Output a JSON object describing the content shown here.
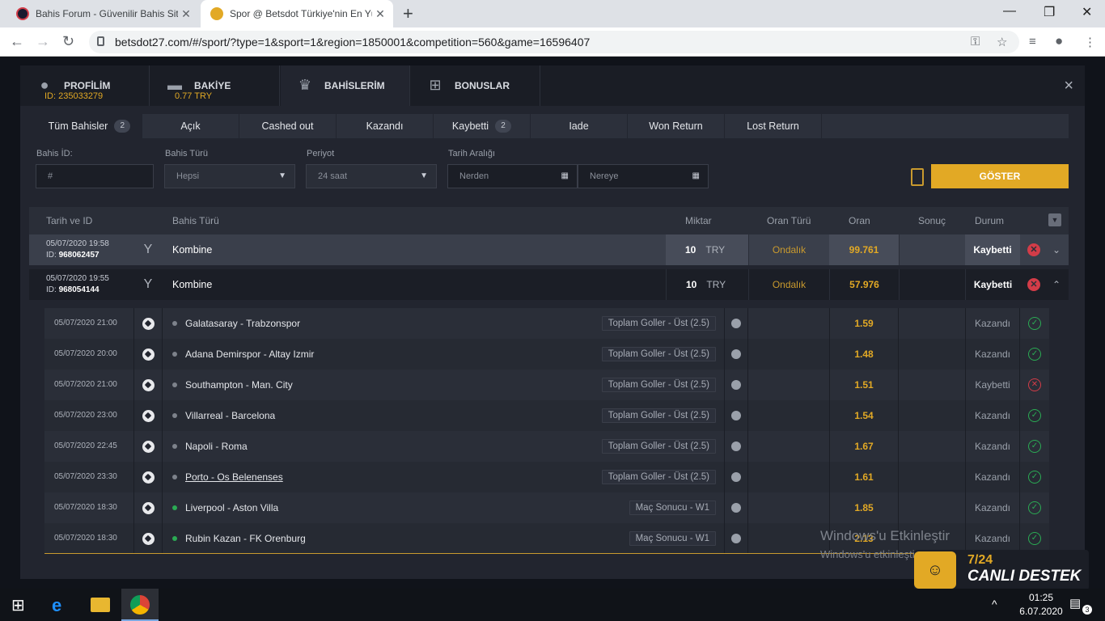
{
  "browser": {
    "tabs": [
      {
        "title": "Bahis Forum - Güvenilir Bahis Sitel",
        "favicon_color": "#1a1a2e"
      },
      {
        "title": "Spor @ Betsdot Türkiye'nin En Yüc",
        "favicon_color": "#e2a925"
      }
    ],
    "url": "betsdot27.com/#/sport/?type=1&sport=1&region=1850001&competition=560&game=16596407"
  },
  "modal": {
    "tabs": [
      {
        "label": "PROFİLİM",
        "sub": "ID: 235033279",
        "icon": "user-icon"
      },
      {
        "label": "BAKİYE",
        "sub": "0.77 TRY",
        "icon": "wallet-icon"
      },
      {
        "label": "BAHİSLERİM",
        "sub": "",
        "icon": "trophy-icon"
      },
      {
        "label": "BONUSLAR",
        "sub": "",
        "icon": "gift-icon"
      }
    ],
    "close": "×"
  },
  "filters": {
    "tabs": [
      {
        "label": "Tüm Bahisler",
        "count": "2"
      },
      {
        "label": "Açık",
        "count": ""
      },
      {
        "label": "Cashed out",
        "count": ""
      },
      {
        "label": "Kazandı",
        "count": ""
      },
      {
        "label": "Kaybetti",
        "count": "2"
      },
      {
        "label": "Iade",
        "count": ""
      },
      {
        "label": "Won Return",
        "count": ""
      },
      {
        "label": "Lost Return",
        "count": ""
      }
    ],
    "bet_id_label": "Bahis İD:",
    "bet_id_placeholder": "#",
    "bet_type_label": "Bahis Türü",
    "bet_type_value": "Hepsi",
    "period_label": "Periyot",
    "period_value": "24 saat",
    "date_range_label": "Tarih Aralığı",
    "from_placeholder": "Nerden",
    "to_placeholder": "Nereye",
    "show_button": "GÖSTER"
  },
  "table": {
    "headers": {
      "date_id": "Tarih ve ID",
      "bet_type": "Bahis Türü",
      "amount": "Miktar",
      "odds_type": "Oran Türü",
      "odds": "Oran",
      "result": "Sonuç",
      "status": "Durum"
    },
    "bets": [
      {
        "date": "05/07/2020 19:58",
        "id_label": "ID:",
        "id": "968062457",
        "type": "Kombine",
        "amount": "10",
        "currency": "TRY",
        "odds_type": "Ondalık",
        "odds": "99.761",
        "status": "Kaybetti",
        "expanded": false
      },
      {
        "date": "05/07/2020 19:55",
        "id_label": "ID:",
        "id": "968054144",
        "type": "Kombine",
        "amount": "10",
        "currency": "TRY",
        "odds_type": "Ondalık",
        "odds": "57.976",
        "status": "Kaybetti",
        "expanded": true
      }
    ],
    "selections": [
      {
        "date": "05/07/2020 21:00",
        "match": "Galatasaray - Trabzonspor",
        "market": "Toplam Goller - Üst (2.5)",
        "odds": "1.59",
        "status": "Kazandı",
        "won": true,
        "live": false
      },
      {
        "date": "05/07/2020 20:00",
        "match": "Adana Demirspor - Altay Izmir",
        "market": "Toplam Goller - Üst (2.5)",
        "odds": "1.48",
        "status": "Kazandı",
        "won": true,
        "live": false
      },
      {
        "date": "05/07/2020 21:00",
        "match": "Southampton - Man. City",
        "market": "Toplam Goller - Üst (2.5)",
        "odds": "1.51",
        "status": "Kaybetti",
        "won": false,
        "live": false
      },
      {
        "date": "05/07/2020 23:00",
        "match": "Villarreal - Barcelona",
        "market": "Toplam Goller - Üst (2.5)",
        "odds": "1.54",
        "status": "Kazandı",
        "won": true,
        "live": false
      },
      {
        "date": "05/07/2020 22:45",
        "match": "Napoli - Roma",
        "market": "Toplam Goller - Üst (2.5)",
        "odds": "1.67",
        "status": "Kazandı",
        "won": true,
        "live": false
      },
      {
        "date": "05/07/2020 23:30",
        "match": "Porto - Os Belenenses",
        "market": "Toplam Goller - Üst (2.5)",
        "odds": "1.61",
        "status": "Kazandı",
        "won": true,
        "live": false
      },
      {
        "date": "05/07/2020 18:30",
        "match": "Liverpool - Aston Villa",
        "market": "Maç Sonucu - W1",
        "odds": "1.85",
        "status": "Kazandı",
        "won": true,
        "live": true
      },
      {
        "date": "05/07/2020 18:30",
        "match": "Rubin Kazan - FK Orenburg",
        "market": "Maç Sonucu - W1",
        "odds": "2.13",
        "status": "Kazandı",
        "won": true,
        "live": true
      }
    ]
  },
  "watermark": {
    "line1": "Windows'u Etkinleştir",
    "line2": "Windows'u etkinleştirmek için Ayarlar'a gidin."
  },
  "support": {
    "hours": "7/24",
    "label": "CANLI DESTEK"
  },
  "taskbar": {
    "time": "01:25",
    "date": "6.07.2020",
    "notifications": "3"
  },
  "colors": {
    "accent": "#e2a925",
    "win": "#2bab54",
    "loss": "#d33c48"
  }
}
